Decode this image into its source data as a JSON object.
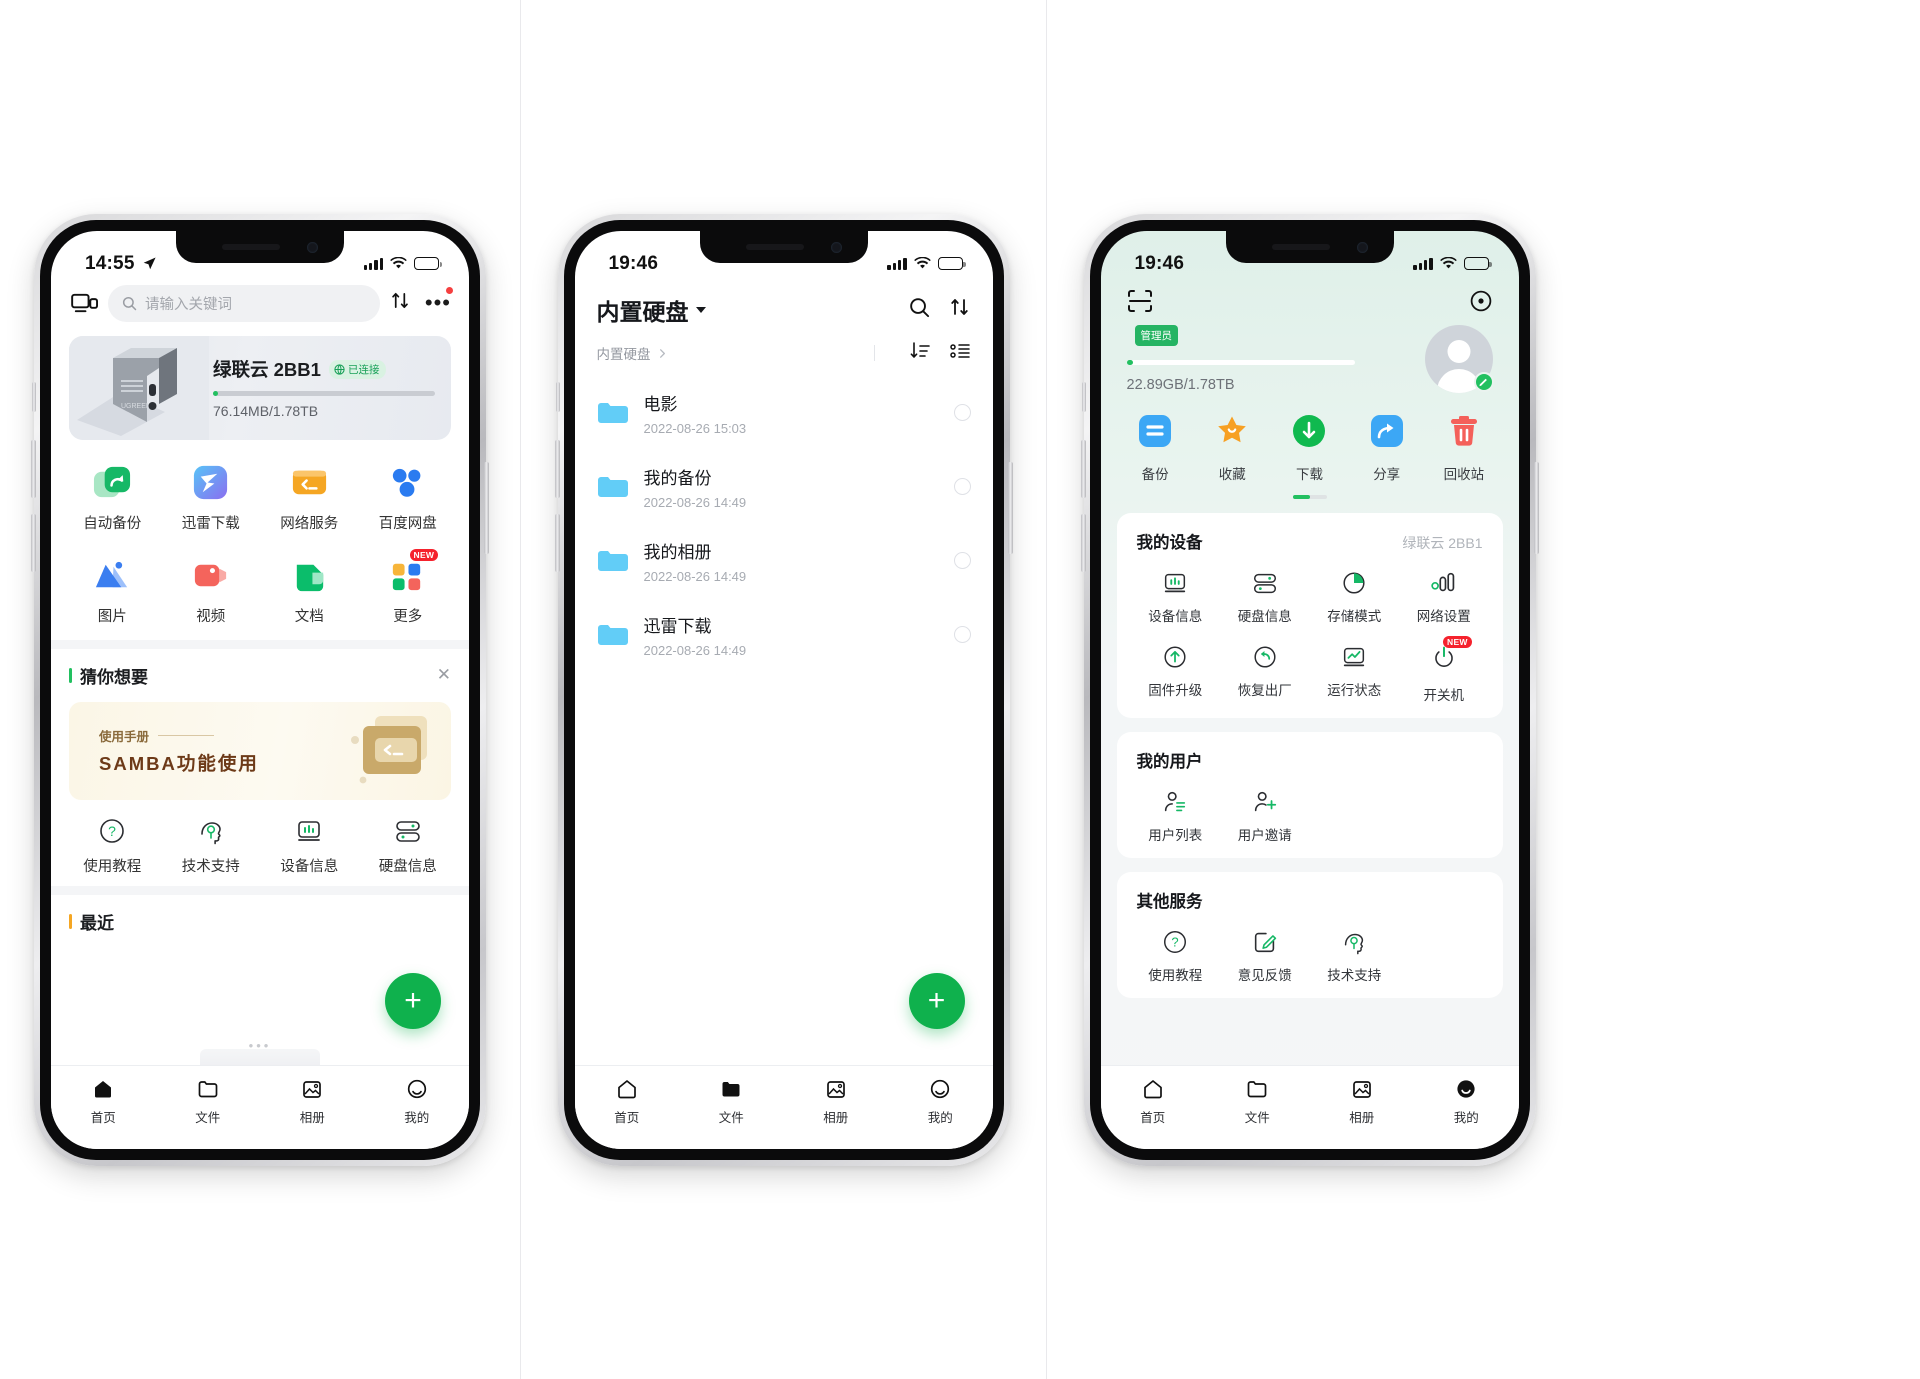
{
  "phone1": {
    "status": {
      "time": "14:55",
      "location_icon": "location-arrow-icon",
      "signal": "signal-bars-icon",
      "wifi": "wifi-icon",
      "battery": "battery-icon"
    },
    "topbar": {
      "cast_icon": "cast-screen-icon",
      "search_placeholder": "请输入关键词",
      "search_icon": "search-icon",
      "sort_icon": "sort-icon",
      "more_icon": "more-dots-icon",
      "has_notification_dot": true
    },
    "device": {
      "name": "绿联云 2BB1",
      "status_badge": "已连接",
      "badge_icon": "globe-icon",
      "storage": "76.14MB/1.78TB",
      "progress_percent": 1,
      "image": "nas-device-photo"
    },
    "apps_row1": [
      {
        "label": "自动备份",
        "icon": "auto-backup-icon",
        "color": "#16b866"
      },
      {
        "label": "迅雷下载",
        "icon": "thunder-download-icon",
        "color": "#4aa8f5"
      },
      {
        "label": "网络服务",
        "icon": "network-service-icon",
        "color": "#f5a623"
      },
      {
        "label": "百度网盘",
        "icon": "baidu-netdisk-icon",
        "color": "#2a7bf0"
      }
    ],
    "apps_row2": [
      {
        "label": "图片",
        "icon": "photo-icon",
        "color": "#3b7ef0"
      },
      {
        "label": "视频",
        "icon": "video-icon",
        "color": "#f4645c"
      },
      {
        "label": "文档",
        "icon": "document-icon",
        "color": "#0bbd6b"
      },
      {
        "label": "更多",
        "icon": "more-apps-icon",
        "color": "#f5a623",
        "badge": "NEW"
      }
    ],
    "guess_section": {
      "title": "猜你想要",
      "close_icon": "close-icon"
    },
    "promo": {
      "subtitle": "使用手册",
      "title": "SAMBA功能使用",
      "art_icon": "folder-terminal-art"
    },
    "tools": [
      {
        "label": "使用教程",
        "icon": "question-circle-icon"
      },
      {
        "label": "技术支持",
        "icon": "tech-support-head-icon"
      },
      {
        "label": "设备信息",
        "icon": "device-info-icon"
      },
      {
        "label": "硬盘信息",
        "icon": "disk-info-icon"
      }
    ],
    "recent_section": {
      "title": "最近"
    },
    "fab": {
      "label": "+",
      "icon": "plus-icon"
    },
    "tabs": [
      {
        "label": "首页",
        "icon": "home-icon",
        "active": true
      },
      {
        "label": "文件",
        "icon": "files-icon",
        "active": false
      },
      {
        "label": "相册",
        "icon": "album-icon",
        "active": false
      },
      {
        "label": "我的",
        "icon": "profile-icon",
        "active": false
      }
    ]
  },
  "phone2": {
    "status": {
      "time": "19:46",
      "signal": "signal-bars-icon",
      "wifi": "wifi-icon",
      "battery": "battery-icon"
    },
    "header": {
      "title": "内置硬盘",
      "caret_icon": "chevron-down-icon",
      "search_icon": "search-icon",
      "sort_icon": "sort-icon"
    },
    "breadcrumb": {
      "label": "内置硬盘",
      "chevron_icon": "chevron-right-icon",
      "sort_icon": "sort-descending-icon",
      "view_icon": "list-view-icon"
    },
    "files": [
      {
        "name": "电影",
        "date": "2022-08-26 15:03",
        "icon": "folder-icon"
      },
      {
        "name": "我的备份",
        "date": "2022-08-26 14:49",
        "icon": "folder-icon"
      },
      {
        "name": "我的相册",
        "date": "2022-08-26 14:49",
        "icon": "folder-icon"
      },
      {
        "name": "迅雷下载",
        "date": "2022-08-26 14:49",
        "icon": "folder-icon"
      }
    ],
    "fab": {
      "label": "+",
      "icon": "plus-icon"
    },
    "tabs": [
      {
        "label": "首页",
        "icon": "home-icon",
        "active": false
      },
      {
        "label": "文件",
        "icon": "files-icon",
        "active": true
      },
      {
        "label": "相册",
        "icon": "album-icon",
        "active": false
      },
      {
        "label": "我的",
        "icon": "profile-icon",
        "active": false
      }
    ]
  },
  "phone3": {
    "status": {
      "time": "19:46",
      "signal": "signal-bars-icon",
      "wifi": "wifi-icon",
      "battery": "battery-icon"
    },
    "topbar": {
      "scan_icon": "scan-code-icon",
      "target_icon": "target-circle-icon"
    },
    "user": {
      "name_redacted": true,
      "role_badge": "管理员",
      "storage": "22.89GB/1.78TB",
      "progress_percent": 2,
      "avatar_icon": "avatar-icon",
      "edit_icon": "edit-pencil-icon"
    },
    "quick_actions": [
      {
        "label": "备份",
        "icon": "backup-icon",
        "color": "#3ca7f5"
      },
      {
        "label": "收藏",
        "icon": "star-icon",
        "color": "#f7a023"
      },
      {
        "label": "下载",
        "icon": "download-icon",
        "color": "#10b94f"
      },
      {
        "label": "分享",
        "icon": "share-icon",
        "color": "#3ca7f5"
      },
      {
        "label": "回收站",
        "icon": "trash-icon",
        "color": "#f4605a"
      }
    ],
    "my_device": {
      "title": "我的设备",
      "device_name": "绿联云 2BB1",
      "items": [
        {
          "label": "设备信息",
          "icon": "device-info-icon"
        },
        {
          "label": "硬盘信息",
          "icon": "disk-info-icon"
        },
        {
          "label": "存储模式",
          "icon": "storage-mode-pie-icon"
        },
        {
          "label": "网络设置",
          "icon": "network-settings-icon"
        },
        {
          "label": "固件升级",
          "icon": "firmware-upgrade-icon"
        },
        {
          "label": "恢复出厂",
          "icon": "factory-reset-icon"
        },
        {
          "label": "运行状态",
          "icon": "running-status-icon"
        },
        {
          "label": "开关机",
          "icon": "power-icon",
          "badge": "NEW"
        }
      ]
    },
    "my_users": {
      "title": "我的用户",
      "items": [
        {
          "label": "用户列表",
          "icon": "user-list-icon"
        },
        {
          "label": "用户邀请",
          "icon": "user-add-icon"
        }
      ]
    },
    "other_services": {
      "title": "其他服务",
      "items": [
        {
          "label": "使用教程",
          "icon": "question-circle-icon"
        },
        {
          "label": "意见反馈",
          "icon": "feedback-edit-icon"
        },
        {
          "label": "技术支持",
          "icon": "tech-support-head-icon"
        }
      ]
    },
    "tabs": [
      {
        "label": "首页",
        "icon": "home-icon",
        "active": false
      },
      {
        "label": "文件",
        "icon": "files-icon",
        "active": false
      },
      {
        "label": "相册",
        "icon": "album-icon",
        "active": false
      },
      {
        "label": "我的",
        "icon": "profile-icon",
        "active": true
      }
    ]
  }
}
